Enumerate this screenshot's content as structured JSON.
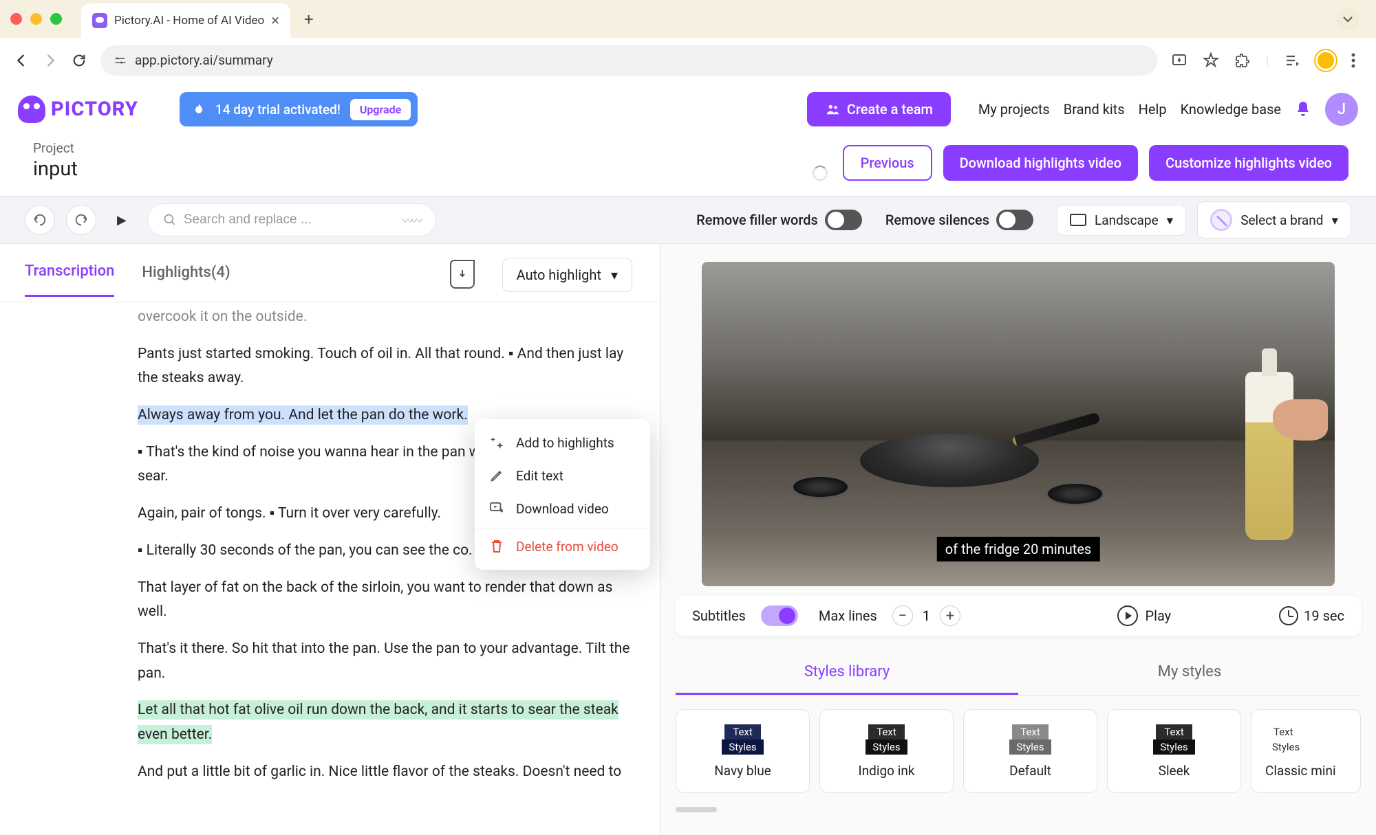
{
  "browser": {
    "tab_title": "Pictory.AI - Home of AI Video",
    "url": "app.pictory.ai/summary"
  },
  "header": {
    "logo_text": "PICTORY",
    "trial_text": "14 day trial activated!",
    "upgrade_label": "Upgrade",
    "create_team_label": "Create a team",
    "nav": {
      "projects": "My projects",
      "brand_kits": "Brand kits",
      "help": "Help",
      "knowledge": "Knowledge base"
    },
    "avatar_initial": "J"
  },
  "project": {
    "label": "Project",
    "name": "input",
    "previous_btn": "Previous",
    "download_btn": "Download highlights video",
    "customize_btn": "Customize highlights video"
  },
  "toolbar": {
    "search_placeholder": "Search and replace ...",
    "remove_filler": "Remove filler words",
    "remove_silences": "Remove silences",
    "orientation": "Landscape",
    "brand_placeholder": "Select a brand"
  },
  "left_panel": {
    "tabs": {
      "transcription": "Transcription",
      "highlights": "Highlights(4)"
    },
    "auto_highlight": "Auto highlight",
    "transcript": {
      "truncated_line": "overcook it on the outside.",
      "p1": "Pants just started smoking. Touch of oil in. All that round.  ▪  And then just lay the steaks away.",
      "p2_highlight": "Always away from you. And let the pan do the work. ",
      "p3": " ▪  That's the kind of noise you wanna hear in the pan when you get a great sear.",
      "p4": "Again, pair of tongs.  ▪  Turn it over very carefully.",
      "p5": " ▪  Literally 30 seconds of the pan, you can see the co.",
      "p6": "That layer of fat on the back of the sirloin, you want to render that down as well.",
      "p7": "That's it there. So hit that into the pan. Use the pan to your advantage. Tilt the pan.",
      "p8_highlight": "Let all that hot fat olive oil run down the back, and it starts to sear the steak even better. ",
      "p9": "And put a little bit of garlic in. Nice little flavor of the steaks. Doesn't need to"
    },
    "context_menu": {
      "add": "Add to highlights",
      "edit": "Edit text",
      "download": "Download video",
      "delete": "Delete from video"
    }
  },
  "video": {
    "caption_text": "of the fridge 20 minutes"
  },
  "controls": {
    "subtitles_label": "Subtitles",
    "max_lines_label": "Max lines",
    "max_lines_value": "1",
    "play_label": "Play",
    "duration": "19 sec"
  },
  "styles_panel": {
    "tabs": {
      "library": "Styles library",
      "mine": "My styles"
    },
    "swatch_top": "Text",
    "swatch_bot": "Styles",
    "cards": {
      "navy": "Navy blue",
      "indigo": "Indigo ink",
      "default": "Default",
      "sleek": "Sleek",
      "classic": "Classic mini"
    }
  }
}
